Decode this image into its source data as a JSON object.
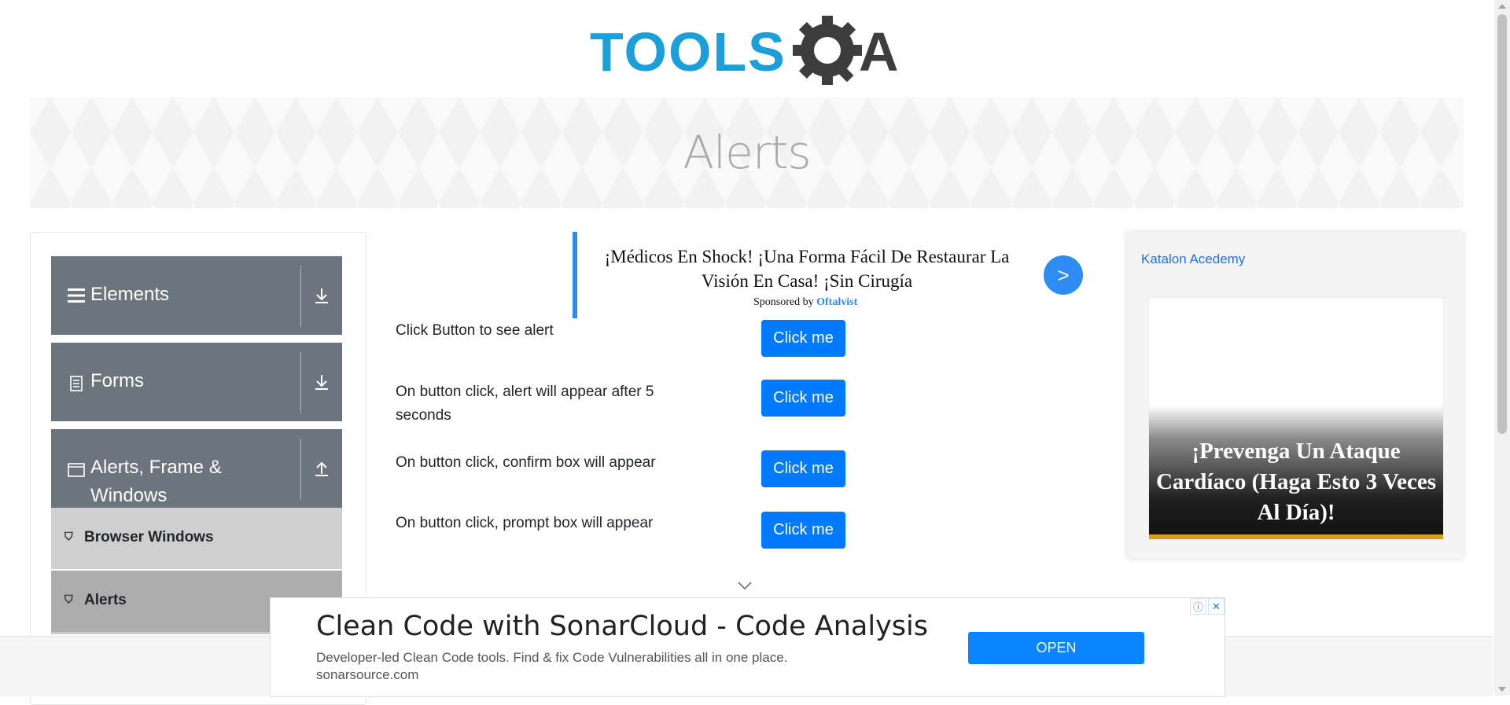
{
  "logo": {
    "brand_left": "TOOLS",
    "brand_right": "A"
  },
  "page": {
    "title": "Alerts"
  },
  "sidebar": {
    "groups": [
      {
        "label": "Elements",
        "icon": "hamburger-icon",
        "state": "collapsed"
      },
      {
        "label": "Forms",
        "icon": "document-icon",
        "state": "collapsed"
      },
      {
        "label_line1": "Alerts, Frame &",
        "label_line2": "Windows",
        "icon": "window-icon",
        "state": "expanded"
      }
    ],
    "items": [
      {
        "label": "Browser Windows",
        "icon": "html5-icon",
        "active": false
      },
      {
        "label": "Alerts",
        "icon": "html5-icon",
        "active": true
      }
    ]
  },
  "ad_top": {
    "headline": "¡Médicos En Shock! ¡Una Forma Fácil De Restaurar La Visión En Casa! ¡Sin Cirugía",
    "sponsored_prefix": "Sponsored by",
    "sponsor": "Oftalvist",
    "go_label": ">"
  },
  "alerts": [
    {
      "label": "Click Button to see alert",
      "button": "Click me"
    },
    {
      "label": "On button click, alert will appear after 5 seconds",
      "button": "Click me"
    },
    {
      "label": "On button click, confirm box will appear",
      "button": "Click me"
    },
    {
      "label": "On button click, prompt box will appear",
      "button": "Click me"
    }
  ],
  "right_ad": {
    "link_text": "Katalon Acedemy",
    "image_text": "¡Prevenga Un Ataque Cardíaco (Haga Esto 3 Veces Al Día)!"
  },
  "bottom_ad": {
    "title": "Clean Code with SonarCloud - Code Analysis",
    "description": "Developer-led Clean Code tools. Find & fix Code Vulnerabilities all in one place.",
    "url": "sonarsource.com",
    "cta": "OPEN",
    "info_icon": "ⓘ",
    "close_icon": "✕"
  },
  "colors": {
    "logo_blue": "#1a9fd9",
    "logo_dark": "#3d3d3d",
    "sidebar_group": "#6c757d",
    "sidebar_item": "#cfcfcf",
    "sidebar_item_active": "#adadad",
    "primary_button": "#007bff",
    "ad_accent": "#2d8cf0"
  }
}
